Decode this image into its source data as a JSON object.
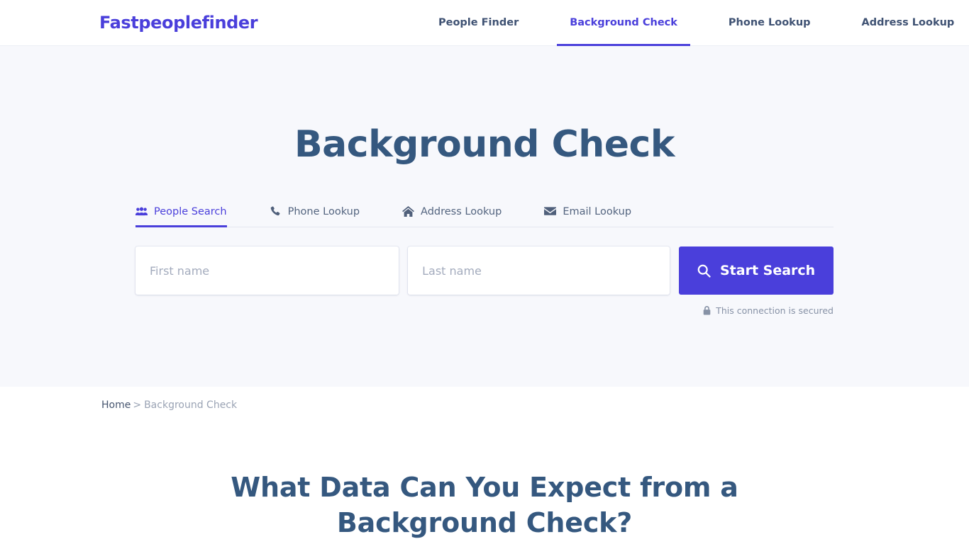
{
  "header": {
    "brand": "Fastpeoplefinder",
    "nav": [
      {
        "label": "People Finder",
        "active": false
      },
      {
        "label": "Background Check",
        "active": true
      },
      {
        "label": "Phone Lookup",
        "active": false
      },
      {
        "label": "Address Lookup",
        "active": false
      }
    ]
  },
  "hero": {
    "title": "Background Check",
    "tabs": [
      {
        "label": "People Search",
        "icon": "users-icon",
        "active": true
      },
      {
        "label": "Phone Lookup",
        "icon": "phone-icon",
        "active": false
      },
      {
        "label": "Address Lookup",
        "icon": "home-icon",
        "active": false
      },
      {
        "label": "Email Lookup",
        "icon": "envelope-icon",
        "active": false
      }
    ],
    "form": {
      "first_name_value": "",
      "first_name_placeholder": "First name",
      "last_name_value": "",
      "last_name_placeholder": "Last name",
      "submit_label": "Start Search",
      "submit_icon": "search-icon"
    },
    "secure_note": "This connection is secured",
    "secure_icon": "lock-icon"
  },
  "breadcrumb": {
    "home": "Home",
    "separator": ">",
    "current": "Background Check"
  },
  "content": {
    "section_heading": "What Data Can You Expect from a Background Check?"
  },
  "colors": {
    "brand_purple": "#4a3fdb",
    "heading_blue": "#35587f",
    "nav_text": "#3f5273",
    "hero_bg": "#f7f8fc",
    "muted_text": "#9aa3b4"
  }
}
